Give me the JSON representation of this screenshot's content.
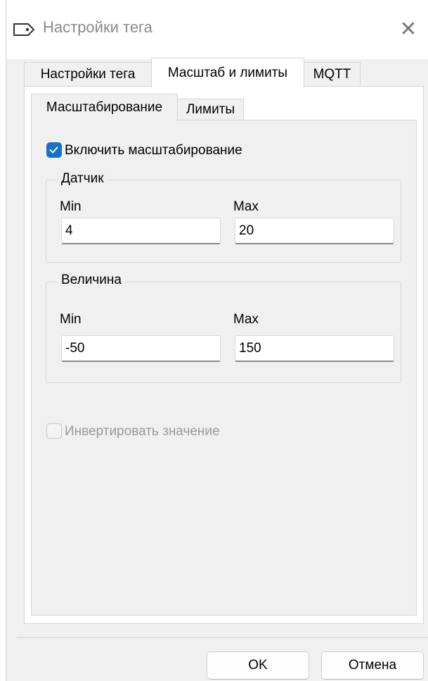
{
  "window": {
    "title": "Настройки тега",
    "close_glyph": "✕"
  },
  "tabs": [
    {
      "label": "Настройки тега",
      "active": false
    },
    {
      "label": "Масштаб и лимиты",
      "active": true
    },
    {
      "label": "MQTT",
      "active": false
    }
  ],
  "subtabs": [
    {
      "label": "Масштабирование",
      "active": true
    },
    {
      "label": "Лимиты",
      "active": false
    }
  ],
  "scaling": {
    "enable_label": "Включить масштабирование",
    "enabled": true,
    "sensor": {
      "legend": "Датчик",
      "min_label": "Min",
      "max_label": "Max",
      "min_value": "4",
      "max_value": "20"
    },
    "quantity": {
      "legend": "Величина",
      "min_label": "Min",
      "max_label": "Max",
      "min_value": "-50",
      "max_value": "150"
    },
    "invert_label": "Инвертировать значение",
    "invert_checked": false,
    "invert_disabled": true
  },
  "buttons": {
    "ok": "OK",
    "cancel": "Отмена"
  },
  "colors": {
    "accent": "#1a6fc6",
    "disabled_text": "#9a9a9a"
  }
}
